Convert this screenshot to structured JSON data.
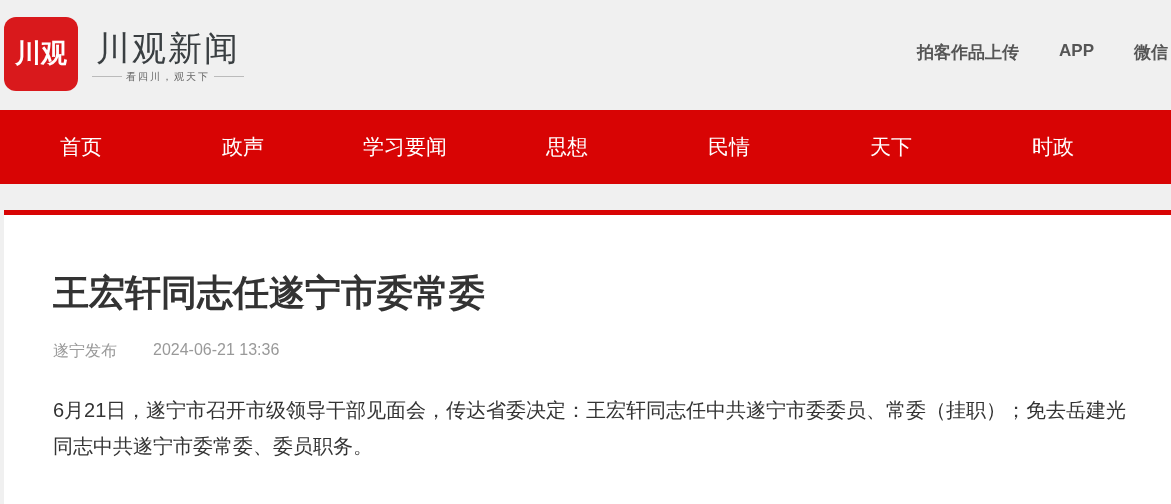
{
  "logo": {
    "mark": "川观",
    "name": "川观新闻",
    "slogan": "看四川，观天下"
  },
  "header_links": [
    "拍客作品上传",
    "APP",
    "微信"
  ],
  "nav": [
    "首页",
    "政声",
    "学习要闻",
    "思想",
    "民情",
    "天下",
    "时政"
  ],
  "article": {
    "title": "王宏轩同志任遂宁市委常委",
    "source": "遂宁发布",
    "date": "2024-06-21 13:36",
    "paragraphs": [
      "6月21日，遂宁市召开市级领导干部见面会，传达省委决定：王宏轩同志任中共遂宁市委委员、常委（挂职）；免去岳建光同志中共遂宁市委常委、委员职务。"
    ]
  }
}
